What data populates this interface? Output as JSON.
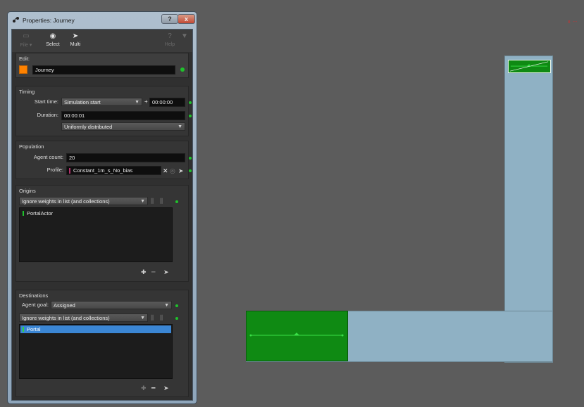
{
  "window": {
    "title": "Properties: Journey",
    "help_button": "?",
    "close_button": "x"
  },
  "toolbar": {
    "file": "File",
    "select": "Select",
    "multi": "Multi",
    "help": "Help"
  },
  "edit": {
    "label": "Edit:",
    "name": "Journey",
    "color": "#ff8200"
  },
  "timing": {
    "title": "Timing",
    "start_label": "Start time:",
    "start_value": "Simulation start",
    "plus": "+",
    "start_offset": "00:00:00",
    "duration_label": "Duration:",
    "duration_value": "00:00:01",
    "distribution": "Uniformly distributed"
  },
  "population": {
    "title": "Population",
    "agent_count_label": "Agent count:",
    "agent_count": "20",
    "profile_label": "Profile:",
    "profile_value": "Constant_1m_s_No_bias"
  },
  "origins": {
    "title": "Origins",
    "weights_mode": "Ignore weights in list (and collections)",
    "items": [
      "PortalActor"
    ]
  },
  "destinations": {
    "title": "Destinations",
    "goal_label": "Agent goal:",
    "goal_value": "Assigned",
    "weights_mode": "Ignore weights in list (and collections)",
    "items": [
      "Portal"
    ],
    "selected_index": 0
  },
  "colors": {
    "accent_selection": "#3b86d4",
    "status_green": "#1fc12c",
    "zone_green": "#0f8a13",
    "corridor": "#8fb1c4",
    "viewport_bg": "#5c5c5c"
  },
  "viewport": {
    "axis_marker": "x --"
  }
}
